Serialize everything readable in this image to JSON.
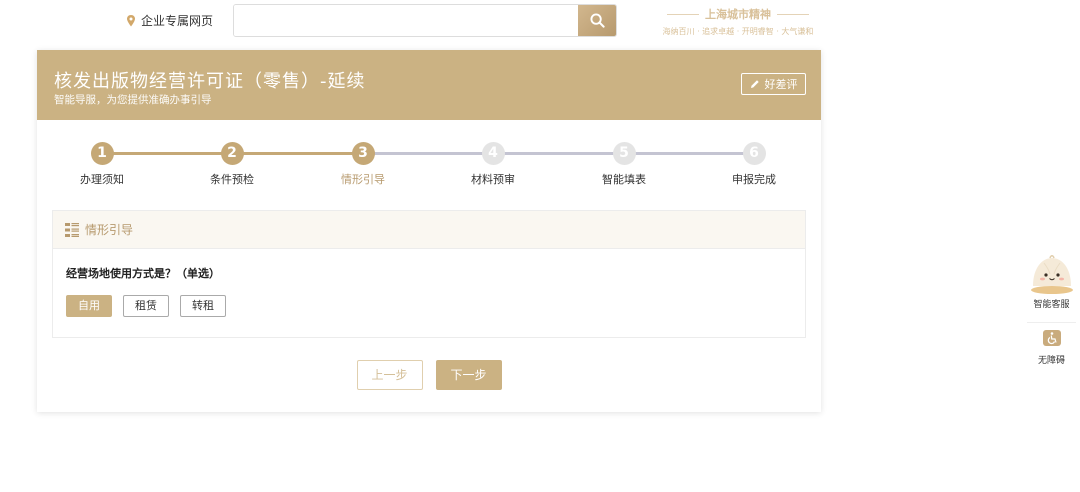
{
  "header": {
    "location_label": "企业专属网页",
    "search_placeholder": "",
    "spirit_title": "上海城市精神",
    "spirit_tagline": "海纳百川 · 追求卓越 · 开明睿智 · 大气谦和"
  },
  "service": {
    "title": "核发出版物经营许可证（零售）-延续",
    "subtitle": "智能导服，为您提供准确办事引导",
    "rate_label": "好差评"
  },
  "steps": [
    {
      "num": "1",
      "label": "办理须知",
      "state": "done"
    },
    {
      "num": "2",
      "label": "条件预检",
      "state": "done"
    },
    {
      "num": "3",
      "label": "情形引导",
      "state": "active"
    },
    {
      "num": "4",
      "label": "材料预审",
      "state": "todo"
    },
    {
      "num": "5",
      "label": "智能填表",
      "state": "todo"
    },
    {
      "num": "6",
      "label": "申报完成",
      "state": "todo"
    }
  ],
  "panel": {
    "title": "情形引导",
    "question": "经营场地使用方式是？（单选）",
    "options": [
      "自用",
      "租赁",
      "转租"
    ],
    "selected": "自用"
  },
  "nav": {
    "prev_label": "上一步",
    "next_label": "下一步"
  },
  "side": {
    "customer_service_label": "智能客服",
    "accessibility_label": "无障碍"
  },
  "colors": {
    "brand": "#cbb283",
    "brand_dark": "#b79a6e",
    "inactive": "#e4e4e4"
  }
}
